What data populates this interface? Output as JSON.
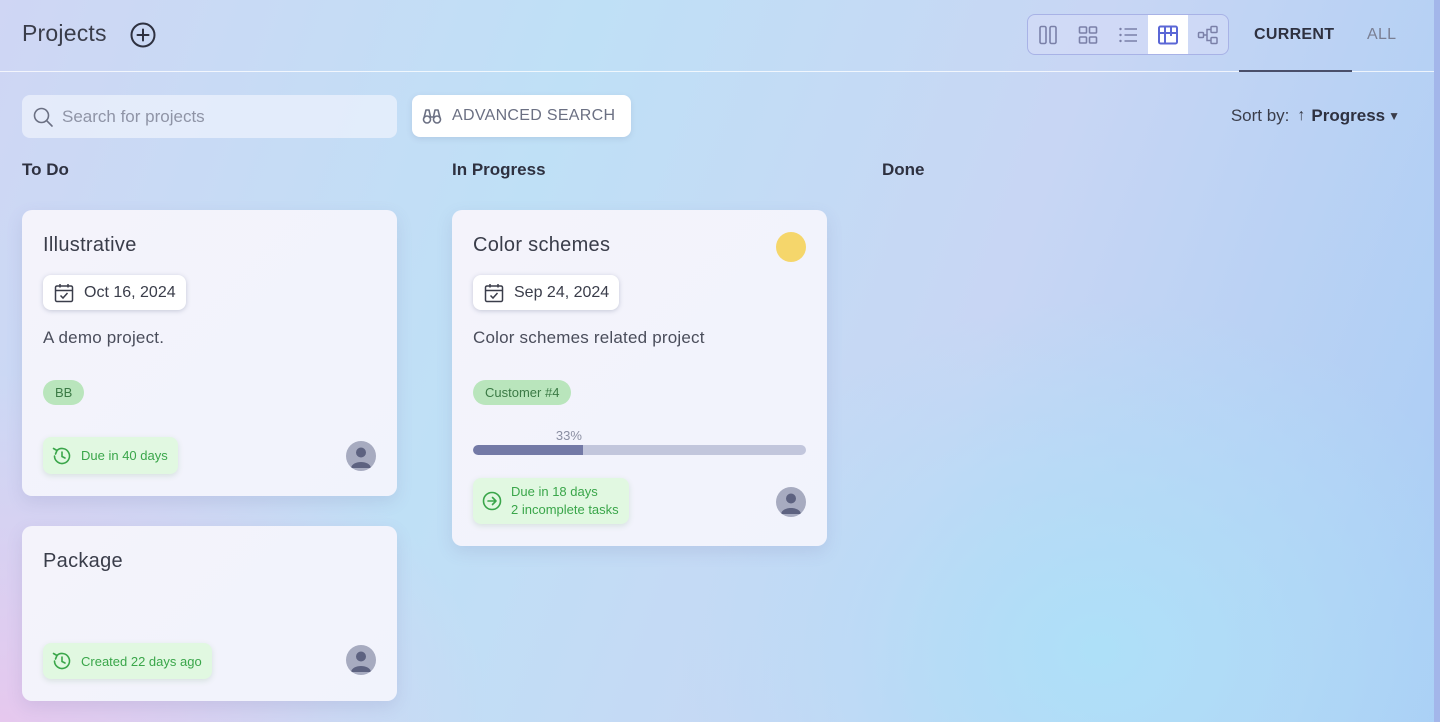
{
  "header": {
    "title": "Projects",
    "add_icon": "plus-circle-icon",
    "views": [
      {
        "name": "columns-view",
        "icon": "columns-icon",
        "active": false
      },
      {
        "name": "grid-view",
        "icon": "grid-icon",
        "active": false
      },
      {
        "name": "list-view",
        "icon": "list-icon",
        "active": false
      },
      {
        "name": "board-view",
        "icon": "board-icon",
        "active": true
      },
      {
        "name": "tree-view",
        "icon": "tree-icon",
        "active": false
      }
    ],
    "tabs": [
      {
        "label": "CURRENT",
        "active": true
      },
      {
        "label": "ALL",
        "active": false
      }
    ]
  },
  "toolbar": {
    "search_placeholder": "Search for projects",
    "advanced_search_label": "ADVANCED SEARCH",
    "sort_label": "Sort by:",
    "sort_direction": "↑",
    "sort_value": "Progress"
  },
  "columns": [
    {
      "title": "To Do",
      "cards": [
        {
          "title": "Illustrative",
          "date": "Oct 16, 2024",
          "description": "A demo project.",
          "tag": "BB",
          "status_lines": [
            "Due in 40 days"
          ],
          "status_icon": "clock-rotate-icon"
        },
        {
          "title": "Package",
          "status_lines": [
            "Created 22 days ago"
          ],
          "status_icon": "history-icon"
        }
      ]
    },
    {
      "title": "In Progress",
      "cards": [
        {
          "title": "Color schemes",
          "date": "Sep 24, 2024",
          "description": "Color schemes related project",
          "tag": "Customer #4",
          "progress": 33,
          "progress_label": "33%",
          "status_lines": [
            "Due in 18 days",
            "2 incomplete tasks"
          ],
          "status_icon": "arrow-right-circle-icon",
          "priority_color": "#f5d66b"
        }
      ]
    },
    {
      "title": "Done",
      "cards": []
    }
  ],
  "colors": {
    "accent": "#5b67d6",
    "tag_bg": "#b9e5bc",
    "status_green": "#3aa64a",
    "progress_fill": "#7379a6"
  }
}
